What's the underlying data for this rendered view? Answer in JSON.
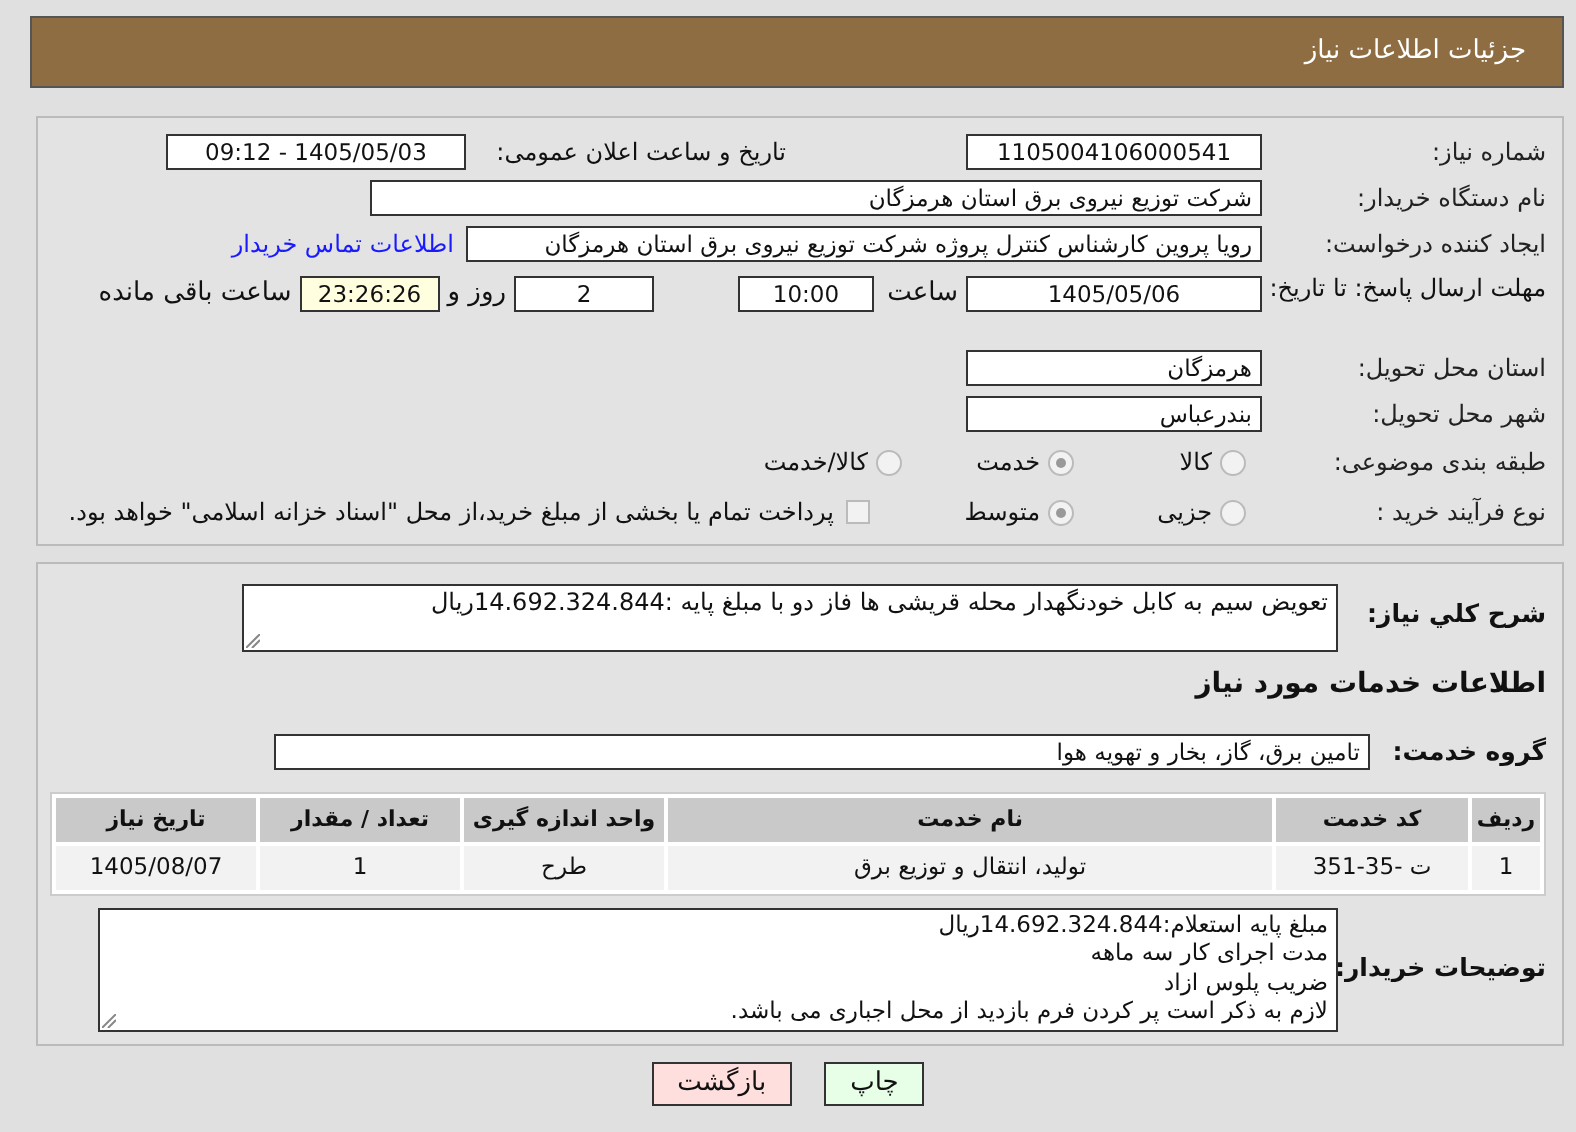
{
  "header": {
    "title": "جزئیات اطلاعات نیاز"
  },
  "need_number": {
    "label": "شماره نیاز:",
    "value": "1105004106000541"
  },
  "announce": {
    "label": "تاریخ و ساعت اعلان عمومی:",
    "value": "1405/05/03 - 09:12"
  },
  "buyer": {
    "label": "نام دستگاه خریدار:",
    "value": "شرکت توزیع نیروی برق استان هرمزگان"
  },
  "creator": {
    "label": "ایجاد کننده درخواست:",
    "value": "رویا پروین کارشناس کنترل پروژه شرکت توزیع نیروی برق استان هرمزگان",
    "link": "اطلاعات تماس خریدار"
  },
  "deadline": {
    "label": "مهلت ارسال پاسخ: تا تاریخ:",
    "date": "1405/05/06",
    "time_label": "ساعت",
    "time": "10:00",
    "days": "2",
    "days_label": "روز و",
    "remaining": "23:26:26",
    "remaining_label": "ساعت باقی مانده"
  },
  "province": {
    "label": "استان محل تحویل:",
    "value": "هرمزگان"
  },
  "city": {
    "label": "شهر محل تحویل:",
    "value": "بندرعباس"
  },
  "category": {
    "label": "طبقه بندی موضوعی:",
    "options": [
      {
        "label": "کالا",
        "selected": false
      },
      {
        "label": "خدمت",
        "selected": true
      },
      {
        "label": "کالا/خدمت",
        "selected": false
      }
    ]
  },
  "process": {
    "label": "نوع فرآیند خرید :",
    "options": [
      {
        "label": "جزیی",
        "selected": false
      },
      {
        "label": "متوسط",
        "selected": true
      }
    ],
    "payment": {
      "checked": false,
      "text": "پرداخت تمام یا بخشی از مبلغ خرید،از محل \"اسناد خزانه اسلامی\" خواهد بود."
    }
  },
  "description": {
    "label": "شرح کلي نیاز:",
    "value": "تعویض سیم به کابل خودنگهدار محله قریشی ها فاز دو با مبلغ پایه :14.692.324.844ریال"
  },
  "services_heading": "اطلاعات خدمات مورد نیاز",
  "service_group": {
    "label": "گروه خدمت:",
    "value": "تامین برق، گاز، بخار و تهویه هوا"
  },
  "table": {
    "columns": [
      "ردیف",
      "کد خدمت",
      "نام خدمت",
      "واحد اندازه گیری",
      "تعداد / مقدار",
      "تاریخ نیاز"
    ],
    "rows": [
      [
        "1",
        "ت -35-351",
        "تولید، انتقال و توزیع برق",
        "طرح",
        "1",
        "1405/08/07"
      ]
    ]
  },
  "buyer_notes": {
    "label": "توضیحات خریدار:",
    "lines": [
      "مبلغ پایه استعلام:14.692.324.844ریال",
      "مدت اجرای کار سه ماهه",
      "ضریب پلوس ازاد",
      "لازم به ذکر است پر کردن فرم بازدید از محل اجباری می باشد."
    ]
  },
  "buttons": [
    {
      "kind": "print",
      "label": "چاپ"
    },
    {
      "kind": "back",
      "label": "بازگشت"
    }
  ]
}
